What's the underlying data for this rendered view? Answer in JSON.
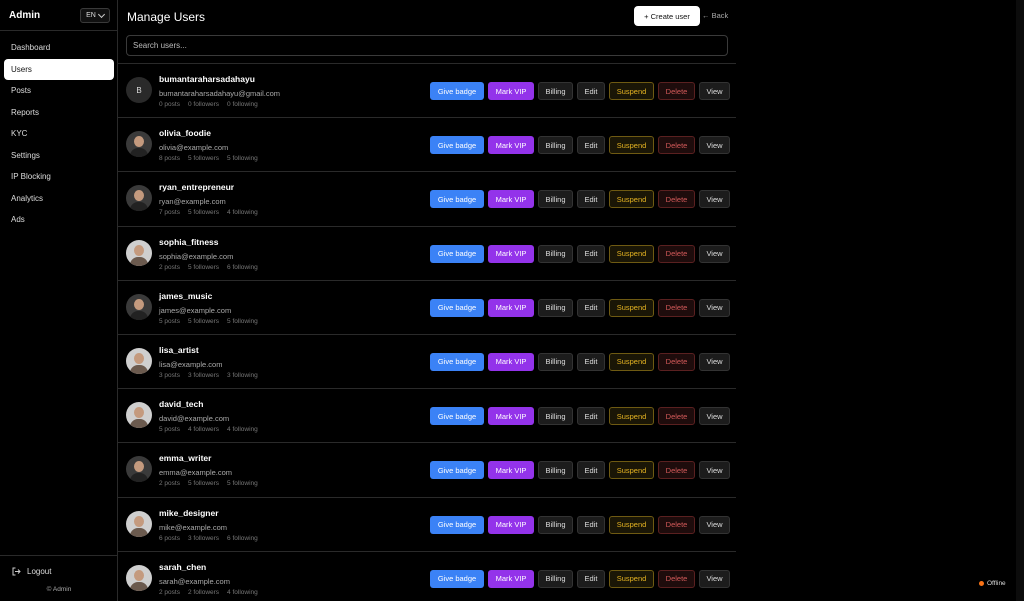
{
  "sidebar": {
    "brand": "Admin",
    "language": "EN",
    "items": [
      {
        "label": "Dashboard",
        "active": false
      },
      {
        "label": "Users",
        "active": true
      },
      {
        "label": "Posts",
        "active": false
      },
      {
        "label": "Reports",
        "active": false
      },
      {
        "label": "KYC",
        "active": false
      },
      {
        "label": "Settings",
        "active": false
      },
      {
        "label": "IP Blocking",
        "active": false
      },
      {
        "label": "Analytics",
        "active": false
      },
      {
        "label": "Ads",
        "active": false
      }
    ],
    "logout_label": "Logout",
    "copyright": "© Admin"
  },
  "header": {
    "title": "Manage Users",
    "create_label": "+ Create user",
    "back_label": "← Back"
  },
  "search": {
    "placeholder": "Search users..."
  },
  "actions": {
    "give_badge": "Give badge",
    "mark_vip": "Mark VIP",
    "billing": "Billing",
    "edit": "Edit",
    "suspend": "Suspend",
    "delete": "Delete",
    "view": "View"
  },
  "users": [
    {
      "username": "bumantaraharsadahayu",
      "email": "bumantaraharsadahayu@gmail.com",
      "posts": "0 posts",
      "followers": "0 followers",
      "following": "0 following",
      "avatar": "initial",
      "initial": "B"
    },
    {
      "username": "olivia_foodie",
      "email": "olivia@example.com",
      "posts": "8 posts",
      "followers": "5 followers",
      "following": "5 following",
      "avatar": "dark"
    },
    {
      "username": "ryan_entrepreneur",
      "email": "ryan@example.com",
      "posts": "7 posts",
      "followers": "5 followers",
      "following": "4 following",
      "avatar": "dark"
    },
    {
      "username": "sophia_fitness",
      "email": "sophia@example.com",
      "posts": "2 posts",
      "followers": "5 followers",
      "following": "6 following",
      "avatar": "light"
    },
    {
      "username": "james_music",
      "email": "james@example.com",
      "posts": "5 posts",
      "followers": "5 followers",
      "following": "5 following",
      "avatar": "dark"
    },
    {
      "username": "lisa_artist",
      "email": "lisa@example.com",
      "posts": "3 posts",
      "followers": "3 followers",
      "following": "3 following",
      "avatar": "light"
    },
    {
      "username": "david_tech",
      "email": "david@example.com",
      "posts": "5 posts",
      "followers": "4 followers",
      "following": "4 following",
      "avatar": "light"
    },
    {
      "username": "emma_writer",
      "email": "emma@example.com",
      "posts": "2 posts",
      "followers": "5 followers",
      "following": "5 following",
      "avatar": "dark"
    },
    {
      "username": "mike_designer",
      "email": "mike@example.com",
      "posts": "6 posts",
      "followers": "3 followers",
      "following": "6 following",
      "avatar": "light"
    },
    {
      "username": "sarah_chen",
      "email": "sarah@example.com",
      "posts": "2 posts",
      "followers": "2 followers",
      "following": "4 following",
      "avatar": "light"
    }
  ],
  "status": {
    "connection": "Offline",
    "color": "#f97316"
  }
}
